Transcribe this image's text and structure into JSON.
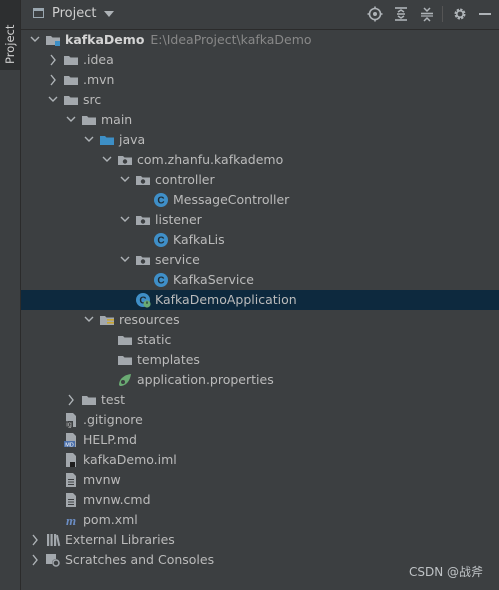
{
  "side_panel": {
    "tab_label": "Project"
  },
  "toolbar": {
    "title": "Project",
    "buttons": [
      {
        "name": "locate-icon"
      },
      {
        "name": "expand-all-icon"
      },
      {
        "name": "collapse-all-icon"
      },
      {
        "name": "settings-icon"
      },
      {
        "name": "hide-icon"
      }
    ]
  },
  "tree": [
    {
      "label": "kafkaDemo",
      "path": "E:\\IdeaProject\\kafkaDemo",
      "depth": 0,
      "chevron": "down",
      "icon": "folder-module",
      "bold": true
    },
    {
      "label": ".idea",
      "depth": 1,
      "chevron": "right",
      "icon": "folder"
    },
    {
      "label": ".mvn",
      "depth": 1,
      "chevron": "right",
      "icon": "folder"
    },
    {
      "label": "src",
      "depth": 1,
      "chevron": "down",
      "icon": "folder"
    },
    {
      "label": "main",
      "depth": 2,
      "chevron": "down",
      "icon": "folder"
    },
    {
      "label": "java",
      "depth": 3,
      "chevron": "down",
      "icon": "folder-source"
    },
    {
      "label": "com.zhanfu.kafkademo",
      "depth": 4,
      "chevron": "down",
      "icon": "package"
    },
    {
      "label": "controller",
      "depth": 5,
      "chevron": "down",
      "icon": "package"
    },
    {
      "label": "MessageController",
      "depth": 6,
      "chevron": "none",
      "icon": "class"
    },
    {
      "label": "listener",
      "depth": 5,
      "chevron": "down",
      "icon": "package"
    },
    {
      "label": "KafkaLis",
      "depth": 6,
      "chevron": "none",
      "icon": "class"
    },
    {
      "label": "service",
      "depth": 5,
      "chevron": "down",
      "icon": "package"
    },
    {
      "label": "KafkaService",
      "depth": 6,
      "chevron": "none",
      "icon": "class"
    },
    {
      "label": "KafkaDemoApplication",
      "depth": 5,
      "chevron": "none",
      "icon": "spring-class",
      "selected": true
    },
    {
      "label": "resources",
      "depth": 3,
      "chevron": "down",
      "icon": "folder-resources"
    },
    {
      "label": "static",
      "depth": 4,
      "chevron": "none",
      "icon": "folder"
    },
    {
      "label": "templates",
      "depth": 4,
      "chevron": "none",
      "icon": "folder"
    },
    {
      "label": "application.properties",
      "depth": 4,
      "chevron": "none",
      "icon": "spring-properties"
    },
    {
      "label": "test",
      "depth": 2,
      "chevron": "right",
      "icon": "folder"
    },
    {
      "label": ".gitignore",
      "depth": 1,
      "chevron": "none",
      "icon": "gitignore-file"
    },
    {
      "label": "HELP.md",
      "depth": 1,
      "chevron": "none",
      "icon": "markdown-file"
    },
    {
      "label": "kafkaDemo.iml",
      "depth": 1,
      "chevron": "none",
      "icon": "iml-file"
    },
    {
      "label": "mvnw",
      "depth": 1,
      "chevron": "none",
      "icon": "text-file"
    },
    {
      "label": "mvnw.cmd",
      "depth": 1,
      "chevron": "none",
      "icon": "text-file"
    },
    {
      "label": "pom.xml",
      "depth": 1,
      "chevron": "none",
      "icon": "maven-file"
    },
    {
      "label": "External Libraries",
      "depth": 0,
      "chevron": "right",
      "icon": "libraries"
    },
    {
      "label": "Scratches and Consoles",
      "depth": 0,
      "chevron": "right",
      "icon": "scratches"
    }
  ],
  "watermark": "CSDN @战斧",
  "colors": {
    "background": "#3c3f41",
    "selection": "#0d293e",
    "folder": "#a3a8ad",
    "source_folder": "#3d8fc6",
    "class_icon": "#3f8fc8",
    "spring": "#6aab73",
    "text": "#bbbbbb"
  }
}
